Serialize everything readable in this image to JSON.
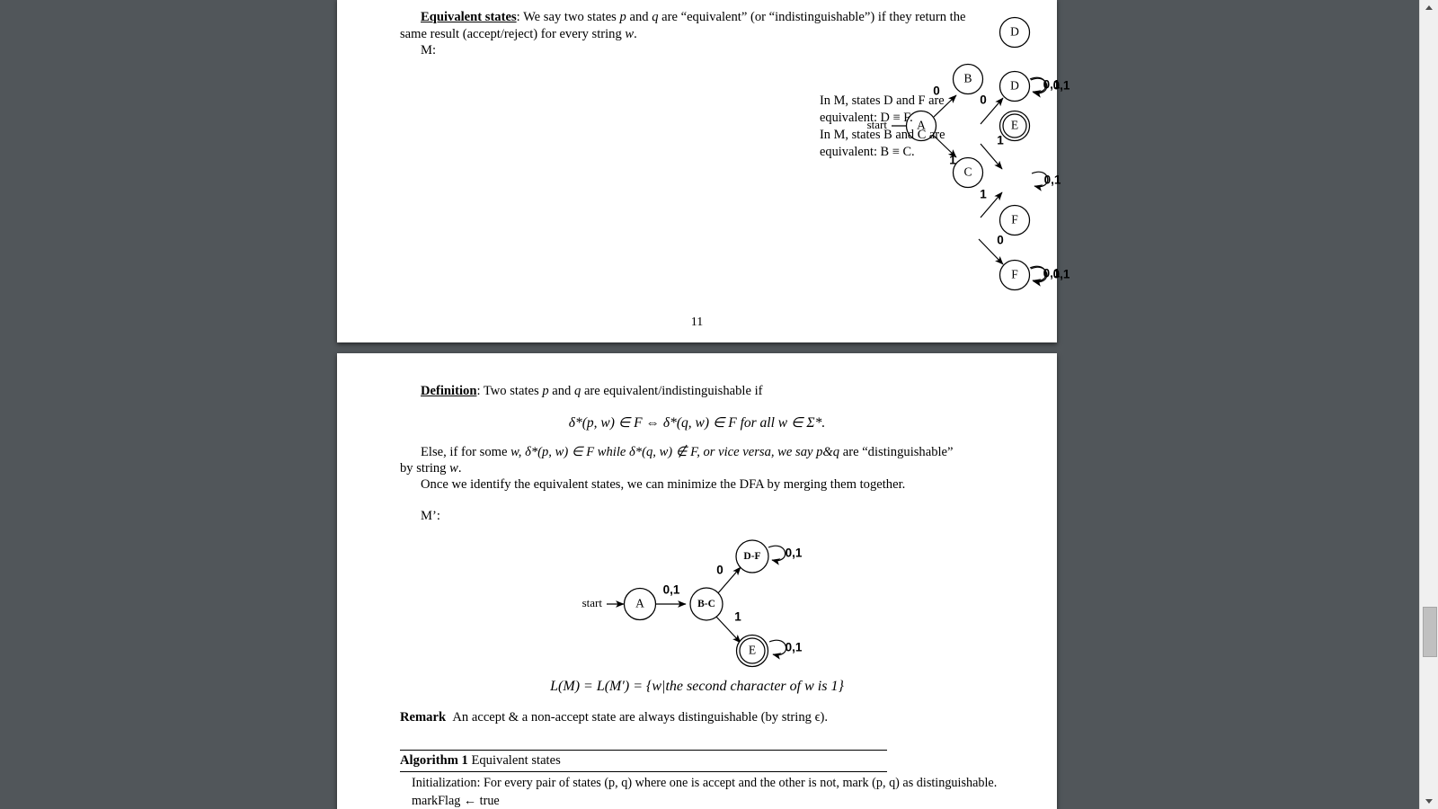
{
  "document": {
    "page_11": {
      "number": "11",
      "equivalent_states": {
        "heading": "Equivalent states",
        "line1_pre": ": We say two states ",
        "p": "p",
        "and": " and ",
        "q": "q",
        "line1_post": " are “equivalent” (or “indistinguishable”) if they return the",
        "line2_pre": "same result (accept/reject) for every string ",
        "w": "w",
        "line2_post": "."
      },
      "machine_label": "M:",
      "side_note": {
        "line1": "In  M,  states  D  and  F  are",
        "line2": "equivalent: D ≡ F.",
        "line3": "In  M,  states  B  and  C  are",
        "line4": "equivalent: B ≡ C."
      },
      "automaton_m": {
        "start_label": "start",
        "states": [
          {
            "id": "A",
            "label": "A",
            "accepting": false
          },
          {
            "id": "B",
            "label": "B",
            "accepting": false
          },
          {
            "id": "C",
            "label": "C",
            "accepting": false
          },
          {
            "id": "D",
            "label": "D",
            "accepting": false
          },
          {
            "id": "E",
            "label": "E",
            "accepting": true
          },
          {
            "id": "F",
            "label": "F",
            "accepting": false
          }
        ],
        "transitions": [
          {
            "from": "A",
            "to": "B",
            "label": "0"
          },
          {
            "from": "A",
            "to": "C",
            "label": "1"
          },
          {
            "from": "B",
            "to": "D",
            "label": "0"
          },
          {
            "from": "B",
            "to": "E",
            "label": "1"
          },
          {
            "from": "C",
            "to": "E",
            "label": "1"
          },
          {
            "from": "C",
            "to": "F",
            "label": "0"
          },
          {
            "from": "D",
            "to": "D",
            "label": "0,1"
          },
          {
            "from": "E",
            "to": "E",
            "label": "0,1"
          },
          {
            "from": "F",
            "to": "F",
            "label": "0,1"
          }
        ]
      }
    },
    "page_12": {
      "definition": {
        "heading": "Definition",
        "line1_pre": ": Two states ",
        "p": "p",
        "and": " and ",
        "q": "q",
        "line1_post": " are equivalent/indistinguishable if"
      },
      "equation_main": "δ*(p, w) ∈ F ⇔ δ*(q, w) ∈ F for all w ∈ Σ*.",
      "else_para": {
        "line1_a": "Else, if for some ",
        "w": "w",
        "line1_b": ", δ*(p, w) ∈ F while δ*(q, w) ∉ F, or vice versa, we say ",
        "pq": "p&q",
        "line1_c": " are “distinguishable”",
        "line2_a": "by string ",
        "line2_b": "."
      },
      "minimize_line": "Once we identify the equivalent states, we can minimize the DFA by merging them together.",
      "machine_label": "M’:",
      "automaton_mprime": {
        "start_label": "start",
        "states": [
          {
            "id": "A",
            "label": "A",
            "accepting": false
          },
          {
            "id": "BC",
            "label": "B-C",
            "accepting": false
          },
          {
            "id": "DF",
            "label": "D-F",
            "accepting": false
          },
          {
            "id": "E",
            "label": "E",
            "accepting": true
          }
        ],
        "transitions": [
          {
            "from": "A",
            "to": "BC",
            "label": "0,1"
          },
          {
            "from": "BC",
            "to": "DF",
            "label": "0"
          },
          {
            "from": "BC",
            "to": "E",
            "label": "1"
          },
          {
            "from": "DF",
            "to": "DF",
            "label": "0,1"
          },
          {
            "from": "E",
            "to": "E",
            "label": "0,1"
          }
        ]
      },
      "language_equation": "L(M) = L(M′) = {w|the second character of w is 1}",
      "remark": {
        "heading": "Remark",
        "text": "An accept & a non-accept state are always distinguishable (by string ϵ)."
      },
      "algorithm": {
        "heading_bold": "Algorithm 1",
        "heading_rest": " Equivalent states",
        "line1": "Initialization: For every pair of states (p, q) where one is accept and the other is not, mark (p, q) as distinguishable.",
        "line2": "markFlag ← true"
      }
    }
  },
  "scrollbar": {
    "up_arrow": "scroll-up",
    "down_arrow": "scroll-down",
    "thumb": "scroll-thumb"
  }
}
